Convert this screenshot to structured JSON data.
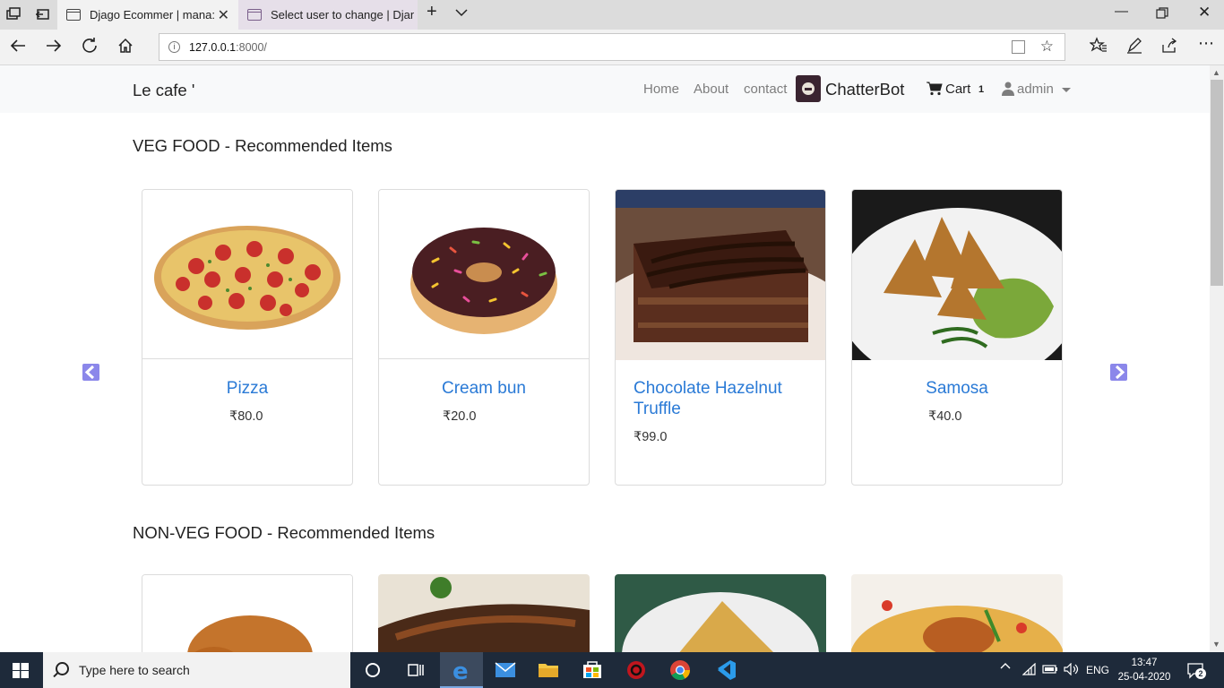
{
  "browser": {
    "tabs": [
      {
        "title": "Djago Ecommer | mana:",
        "active": true
      },
      {
        "title": "Select user to change | Djan",
        "active": false
      }
    ],
    "url": "127.0.0.1:8000/",
    "url_host": "127.0.0.1",
    "url_port": ":8000/"
  },
  "navbar": {
    "brand": "Le cafe '",
    "links": [
      "Home",
      "About",
      "contact"
    ],
    "chatbot": "ChatterBot",
    "cart_label": "Cart",
    "cart_count": "1",
    "user": "admin"
  },
  "sections": [
    {
      "title": "VEG FOOD - Recommended Items",
      "items": [
        {
          "name": "Pizza",
          "price": "₹80.0"
        },
        {
          "name": "Cream bun",
          "price": "₹20.0"
        },
        {
          "name": "Chocolate Hazelnut Truffle",
          "price": "₹99.0"
        },
        {
          "name": "Samosa",
          "price": "₹40.0"
        }
      ]
    },
    {
      "title": "NON-VEG FOOD - Recommended Items",
      "items": []
    }
  ],
  "taskbar": {
    "search_placeholder": "Type here to search",
    "language": "ENG",
    "time": "13:47",
    "date": "25-04-2020",
    "notification_count": "2"
  },
  "colors": {
    "link_blue": "#2a7ad6",
    "carousel_arrow": "#8b87ea",
    "navbar_bg": "#f8f9fa"
  }
}
